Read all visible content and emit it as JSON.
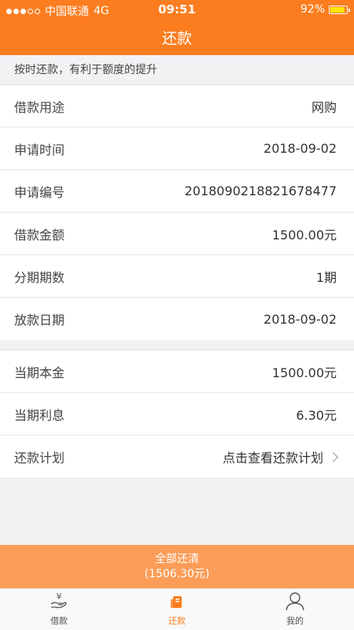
{
  "status_bar": {
    "carrier": "中国联通",
    "network": "4G",
    "time": "09:51",
    "battery": "92%",
    "battery_level": 0.92
  },
  "nav": {
    "title": "还款"
  },
  "tip": "按时还款，有利于额度的提升",
  "loan_details": [
    {
      "label": "借款用途",
      "value": "网购"
    },
    {
      "label": "申请时间",
      "value": "2018-09-02"
    },
    {
      "label": "申请编号",
      "value": "2018090218821678477"
    },
    {
      "label": "借款金额",
      "value": "1500.00元"
    },
    {
      "label": "分期期数",
      "value": "1期"
    },
    {
      "label": "放款日期",
      "value": "2018-09-02"
    }
  ],
  "period_details": [
    {
      "label": "当期本金",
      "value": "1500.00元"
    },
    {
      "label": "当期利息",
      "value": "6.30元"
    }
  ],
  "repayment_plan": {
    "label": "还款计划",
    "link": "点击查看还款计划"
  },
  "pay_button": {
    "label": "全部还清",
    "amount": "(1506.30元)"
  },
  "tabs": [
    {
      "label": "借款",
      "icon": "loan-hand-icon"
    },
    {
      "label": "还款",
      "icon": "repay-icon",
      "active": true
    },
    {
      "label": "我的",
      "icon": "user-icon"
    }
  ],
  "colors": {
    "accent": "#fb7d1f",
    "button": "#fb9d58",
    "background": "#f2f2f4"
  }
}
